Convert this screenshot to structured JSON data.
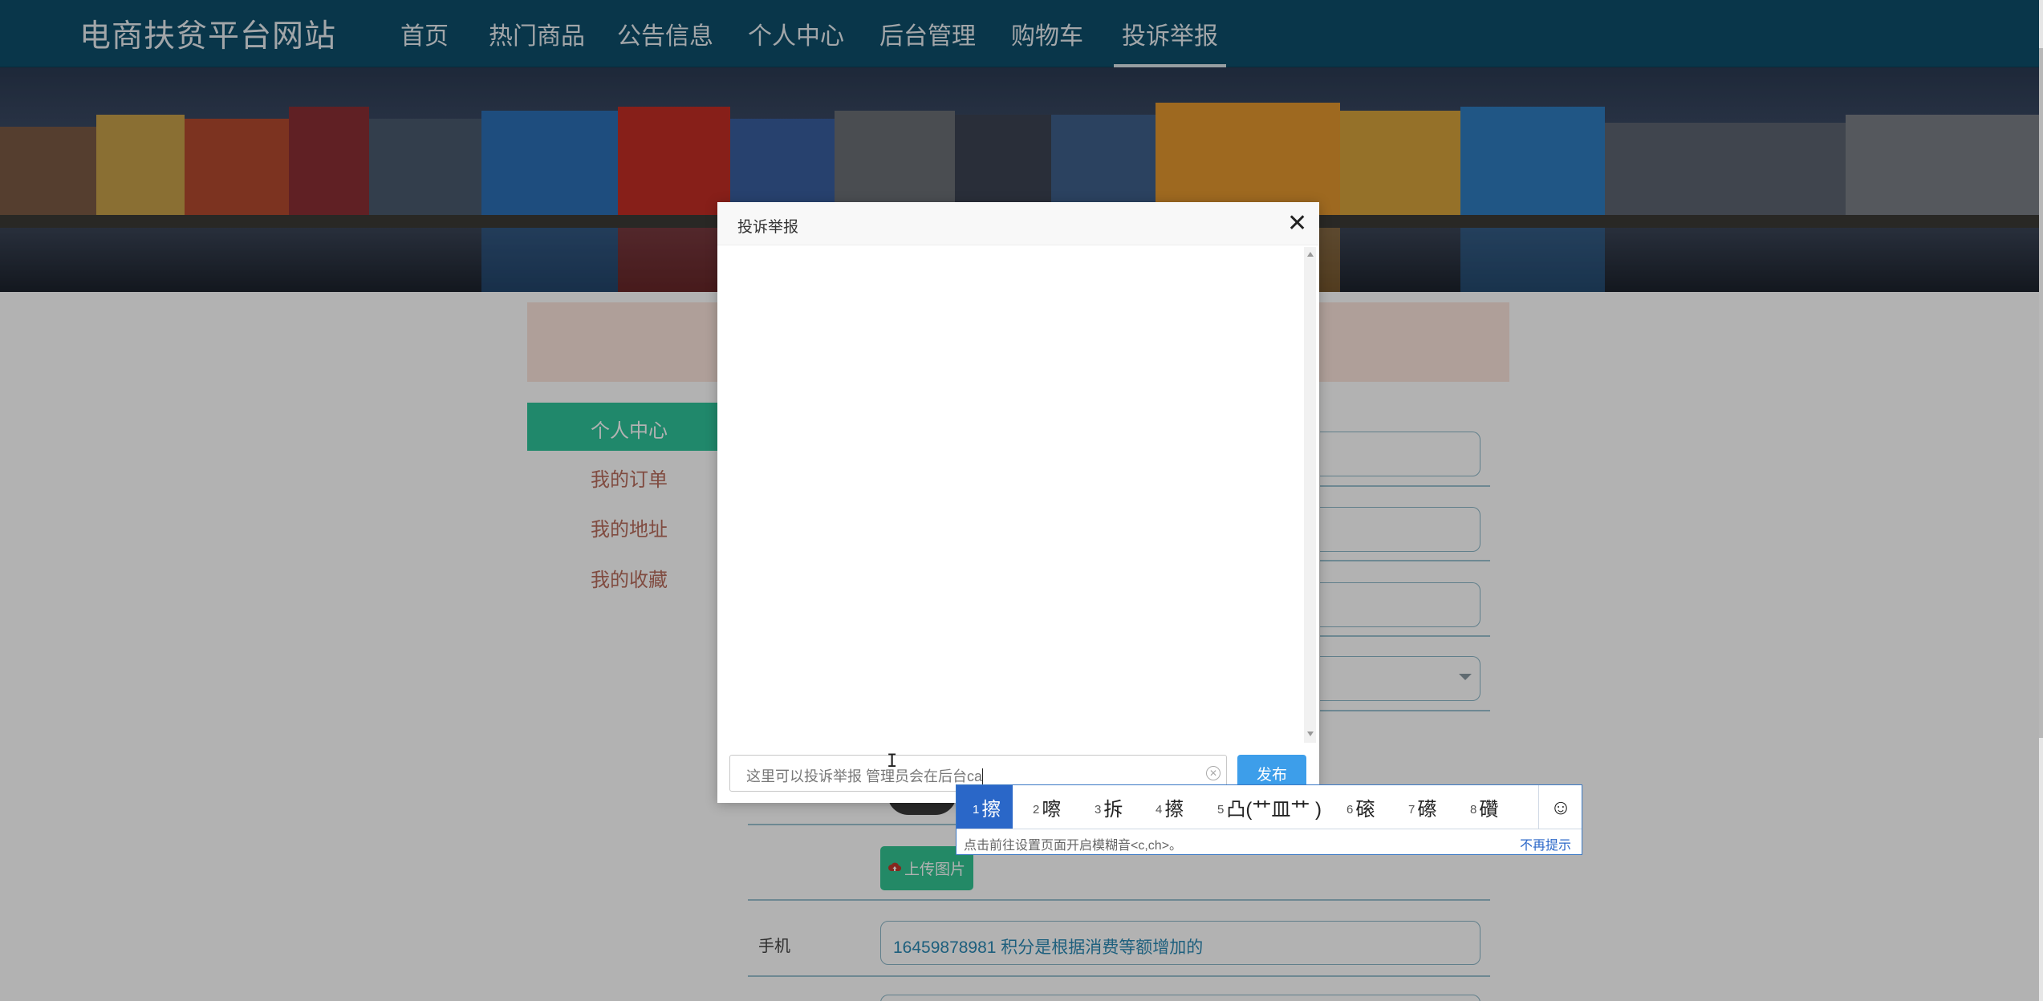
{
  "site": {
    "title": "电商扶贫平台网站",
    "nav": [
      "首页",
      "热门商品",
      "公告信息",
      "个人中心",
      "后台管理",
      "购物车",
      "投诉举报"
    ],
    "active_nav": "投诉举报"
  },
  "sidebar": {
    "items": [
      "个人中心",
      "我的订单",
      "我的地址",
      "我的收藏"
    ],
    "active": "个人中心"
  },
  "profile": {
    "upload_label": "上传图片",
    "phone_label": "手机",
    "phone_value": "16459878981 积分是根据消费等额增加的"
  },
  "modal": {
    "title": "投诉举报",
    "close_icon": "close-icon",
    "input_value": "这里可以投诉举报 管理员会在后台ca",
    "submit_label": "发布"
  },
  "ime": {
    "candidates": [
      {
        "index": "1",
        "text": "擦"
      },
      {
        "index": "2",
        "text": "嚓"
      },
      {
        "index": "3",
        "text": "拆"
      },
      {
        "index": "4",
        "text": "攃"
      },
      {
        "index": "5",
        "text": "凸(艹皿艹 )"
      },
      {
        "index": "6",
        "text": "磙"
      },
      {
        "index": "7",
        "text": "礤"
      },
      {
        "index": "8",
        "text": "礸"
      }
    ],
    "selected_index": 0,
    "hint": "点击前往设置页面开启模糊音<c,ch>。",
    "dismiss_label": "不再提示",
    "emoji_icon": "smiley-icon"
  },
  "colors": {
    "nav_bg": "#0e4e6a",
    "sidebar_active": "#2fc39a",
    "publish_button": "#3d9eea",
    "ime_selected": "#2a67c8"
  }
}
